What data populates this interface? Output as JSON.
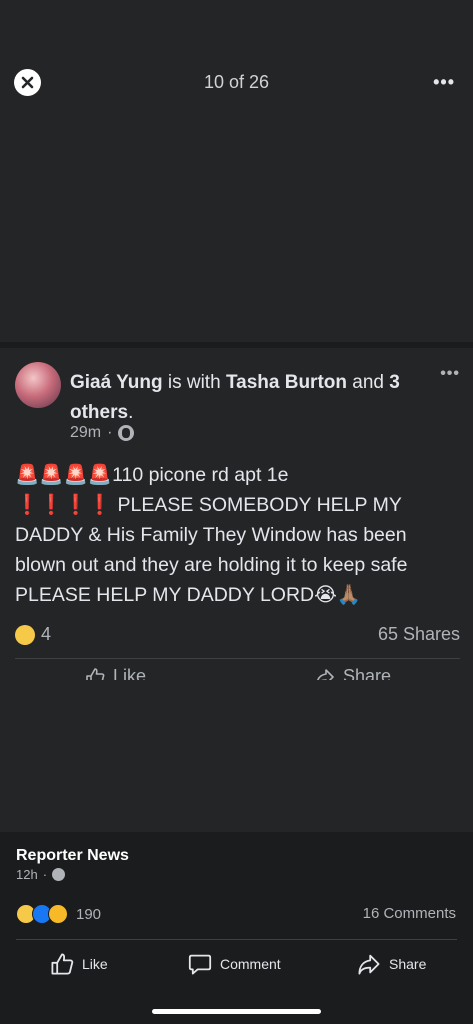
{
  "viewer": {
    "counter": "10 of 26",
    "more_label": "•••",
    "close_label": "×"
  },
  "post": {
    "author": "Giaá Yung",
    "is_with": "is with",
    "tagged": "Tasha Burton",
    "and": "and",
    "others": "3 others",
    "period": ".",
    "time": "29m",
    "separator": "·",
    "more_label": "•••",
    "siren": "🚨🚨🚨🚨",
    "address": "110 picone rd apt 1e",
    "exclaim": "❗❗❗❗",
    "message": "PLEASE SOMEBODY HELP MY DADDY & His Family They Window has been blown out and they are holding it to keep safe PLEASE HELP MY DADDY LORD",
    "end_emojis": "😭🙏🏽",
    "reaction_count": "4",
    "shares": "65 Shares",
    "like_label": "Like",
    "share_label": "Share"
  },
  "footer": {
    "source": "Reporter News",
    "time": "12h",
    "separator": "·",
    "reaction_count": "190",
    "comments": "16 Comments",
    "like_label": "Like",
    "comment_label": "Comment",
    "share_label": "Share"
  },
  "colors": {
    "background": "#242526",
    "panel": "#1b1c1d",
    "text": "#e4e6eb",
    "muted": "#b0b3b8",
    "sad": "#f7c948",
    "like": "#1877f2",
    "care": "#f7b928",
    "alert": "#ff3b30"
  }
}
